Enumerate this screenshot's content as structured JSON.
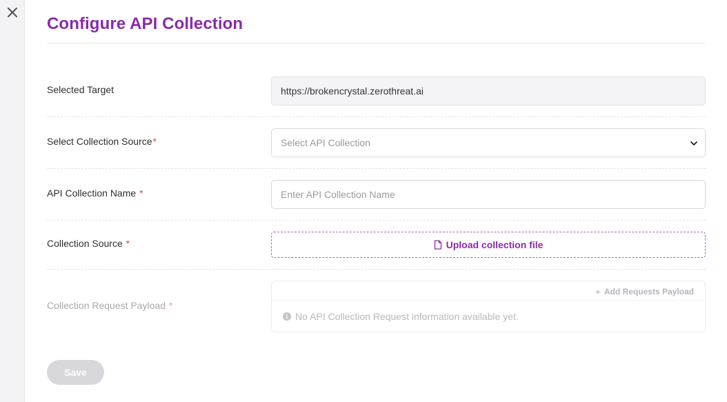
{
  "page": {
    "title": "Configure API Collection",
    "close_icon": "close-icon"
  },
  "form": {
    "selected_target": {
      "label": "Selected Target",
      "value": "https://brokencrystal.zerothreat.ai"
    },
    "collection_source_select": {
      "label": "Select Collection Source",
      "required_mark": "*",
      "placeholder": "Select API Collection",
      "icon": "chevron-down-icon"
    },
    "collection_name": {
      "label": "API Collection Name",
      "required_mark": "*",
      "placeholder": "Enter API Collection Name",
      "value": ""
    },
    "collection_source_upload": {
      "label": "Collection Source",
      "required_mark": "*",
      "button_label": "Upload collection file",
      "icon": "file-icon"
    },
    "request_payload": {
      "label": "Collection Request Payload",
      "required_mark": "*",
      "add_label": "Add Requests Payload",
      "add_icon": "plus-icon",
      "empty_message": "No API Collection Request information available yet.",
      "empty_icon": "info-icon"
    },
    "save_label": "Save"
  },
  "colors": {
    "accent": "#8a2aa8",
    "required": "#e0473d",
    "disabled_button": "#d8d8dc"
  }
}
